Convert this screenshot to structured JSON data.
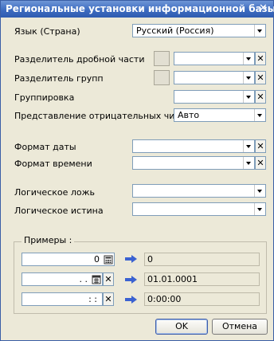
{
  "window": {
    "title": "Региональные установки информационной базы"
  },
  "icons": {
    "close": "close-icon",
    "calculator": "calculator-icon",
    "calendar": "calendar-icon",
    "arrow": "arrow-right-icon"
  },
  "fields": {
    "language": {
      "label": "Язык (Страна)",
      "value": "Русский (Россия)"
    },
    "decimal_separator": {
      "label": "Разделитель дробной части",
      "value": ""
    },
    "group_separator": {
      "label": "Разделитель групп",
      "value": ""
    },
    "grouping": {
      "label": "Группировка",
      "value": ""
    },
    "negative_format": {
      "label": "Представление отрицательных чисел",
      "value": "Авто"
    },
    "date_format": {
      "label": "Формат даты",
      "value": ""
    },
    "time_format": {
      "label": "Формат времени",
      "value": ""
    },
    "bool_false": {
      "label": "Логическое ложь",
      "value": ""
    },
    "bool_true": {
      "label": "Логическое истина",
      "value": ""
    }
  },
  "examples": {
    "label": "Примеры :",
    "number_input": "0",
    "number_result": "0",
    "date_input": ". .",
    "date_result": "01.01.0001",
    "time_input": ": :",
    "time_result": "0:00:00"
  },
  "buttons": {
    "ok": "OK",
    "cancel": "Отмена"
  }
}
